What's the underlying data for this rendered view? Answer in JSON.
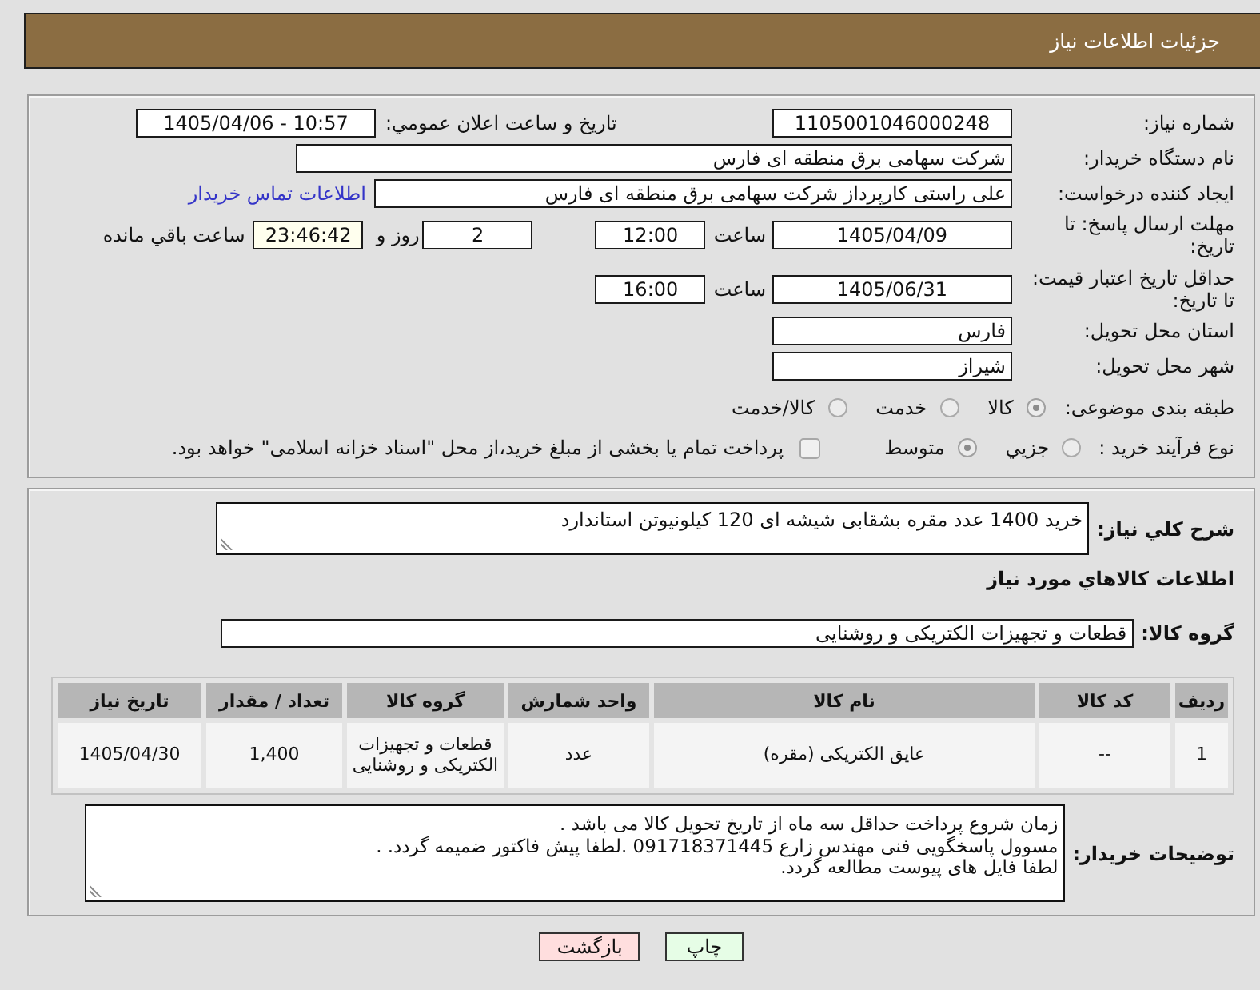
{
  "header": {
    "title": "جزئیات اطلاعات نیاز"
  },
  "details": {
    "need_number": {
      "label": "شماره نیاز:",
      "value": "1105001046000248"
    },
    "announcement": {
      "label": "تاریخ و ساعت اعلان عمومي:",
      "value": "1405/04/06 - 10:57"
    },
    "buyer_org": {
      "label": "نام دستگاه خریدار:",
      "value": "شرکت سهامی برق منطقه ای فارس"
    },
    "requester": {
      "label": "ایجاد کننده درخواست:",
      "value": "علی راستی کارپرداز شرکت سهامی برق منطقه ای فارس",
      "contact_link": "اطلاعات تماس خریدار"
    },
    "reply_deadline": {
      "label": "مهلت ارسال پاسخ: تا تاریخ:",
      "date": "1405/04/09",
      "time_label": "ساعت",
      "time": "12:00",
      "days": "2",
      "days_label": "روز و",
      "remaining": "23:46:42",
      "remaining_label": "ساعت باقي مانده"
    },
    "price_validity": {
      "label": "حداقل تاریخ اعتبار قیمت: تا تاریخ:",
      "date": "1405/06/31",
      "time_label": "ساعت",
      "time": "16:00"
    },
    "province": {
      "label": "استان محل تحویل:",
      "value": "فارس"
    },
    "city": {
      "label": "شهر محل تحویل:",
      "value": "شیراز"
    },
    "category": {
      "label": "طبقه بندی موضوعی:",
      "options": [
        {
          "label": "کالا",
          "selected": true
        },
        {
          "label": "خدمت",
          "selected": false
        },
        {
          "label": "کالا/خدمت",
          "selected": false
        }
      ]
    },
    "purchase_process": {
      "label": "نوع فرآیند خرید :",
      "options": [
        {
          "label": "جزيي",
          "selected": false
        },
        {
          "label": "متوسط",
          "selected": true
        }
      ],
      "treasury_payment": {
        "label": "پرداخت تمام یا بخشی از مبلغ خرید،از محل \"اسناد خزانه اسلامی\" خواهد بود.",
        "checked": false
      }
    }
  },
  "summary": {
    "label": "شرح کلي نیاز:",
    "value": "خرید 1400 عدد مقره بشقابی شیشه ای 120 کیلونیوتن استاندارد"
  },
  "goods": {
    "title": "اطلاعات کالاهاي مورد نیاز",
    "group": {
      "label": "گروه کالا:",
      "value": "قطعات و تجهیزات الکتریکی و روشنایی"
    },
    "table": {
      "columns": [
        "ردیف",
        "کد کالا",
        "نام کالا",
        "واحد شمارش",
        "گروه کالا",
        "تعداد / مقدار",
        "تاریخ نیاز"
      ],
      "rows": [
        [
          "1",
          "--",
          "عایق الکتریکی (مقره)",
          "عدد",
          "قطعات و تجهیزات الکتریکی و روشنایی",
          "1,400",
          "1405/04/30"
        ]
      ]
    }
  },
  "buyer_notes": {
    "label": "توضیحات خریدار:",
    "lines": [
      "زمان شروع پرداخت حداقل سه ماه از تاریخ تحویل کالا می باشد .",
      "مسوول پاسخگویی فنی مهندس زارع 091718371445 .لطفا پیش فاکتور ضمیمه گردد. .",
      "لطفا فایل های پیوست مطالعه گردد."
    ]
  },
  "buttons": [
    {
      "label": "چاپ",
      "kind": "print"
    },
    {
      "label": "بازگشت",
      "kind": "back"
    }
  ]
}
